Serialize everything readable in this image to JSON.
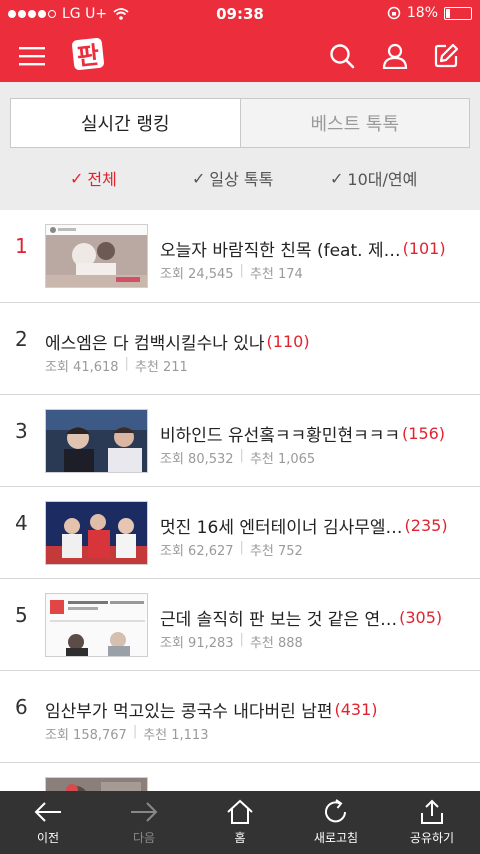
{
  "status": {
    "carrier": "LG U+",
    "time": "09:38",
    "battery": "18%",
    "battery_level": 0.18
  },
  "header": {
    "logo_text": "판"
  },
  "tabs": [
    {
      "label": "실시간 랭킹",
      "active": true
    },
    {
      "label": "베스트 톡톡",
      "active": false
    }
  ],
  "filters": [
    {
      "label": "전체",
      "active": true
    },
    {
      "label": "일상 톡톡",
      "active": false
    },
    {
      "label": "10대/연예",
      "active": false
    }
  ],
  "list": [
    {
      "rank": "1",
      "title": "오늘자 바람직한 친목 (feat. 제…",
      "comments": "(101)",
      "views": "조회 24,545",
      "likes": "추천 174",
      "has_thumb": true,
      "thumb": "photo-crowd"
    },
    {
      "rank": "2",
      "title": "에스엠은 다 컴백시킬수나 있나",
      "comments": "(110)",
      "views": "조회 41,618",
      "likes": "추천 211",
      "has_thumb": false
    },
    {
      "rank": "3",
      "title": "비하인드 유선홐ㅋㅋ황민현ㅋㅋㅋ",
      "comments": "(156)",
      "views": "조회 80,532",
      "likes": "추천 1,065",
      "has_thumb": true,
      "thumb": "photo-stage-blue"
    },
    {
      "rank": "4",
      "title": "멋진 16세 엔터테이너 김사무엘…",
      "comments": "(235)",
      "views": "조회 62,627",
      "likes": "추천 752",
      "has_thumb": true,
      "thumb": "photo-stage-red"
    },
    {
      "rank": "5",
      "title": "근데 솔직히 판 보는 것 같은 연…",
      "comments": "(305)",
      "views": "조회 91,283",
      "likes": "추천 888",
      "has_thumb": true,
      "thumb": "screenshot-doc"
    },
    {
      "rank": "6",
      "title": "임산부가 먹고있는 콩국수 내다버린 남편",
      "comments": "(431)",
      "views": "조회 158,767",
      "likes": "추천 1,113",
      "has_thumb": false
    },
    {
      "rank": "7",
      "title": "",
      "comments": "",
      "views": "",
      "likes": "",
      "has_thumb": true,
      "thumb": "photo-partial"
    }
  ],
  "toolbar": [
    {
      "label": "이전",
      "icon": "arrow-left-icon",
      "enabled": true
    },
    {
      "label": "다음",
      "icon": "arrow-right-icon",
      "enabled": false
    },
    {
      "label": "홈",
      "icon": "home-icon",
      "enabled": true
    },
    {
      "label": "새로고침",
      "icon": "refresh-icon",
      "enabled": true
    },
    {
      "label": "공유하기",
      "icon": "share-icon",
      "enabled": true
    }
  ],
  "colors": {
    "brand": "#ec2d3b",
    "accent": "#e0242f",
    "toolbar": "#333333"
  }
}
